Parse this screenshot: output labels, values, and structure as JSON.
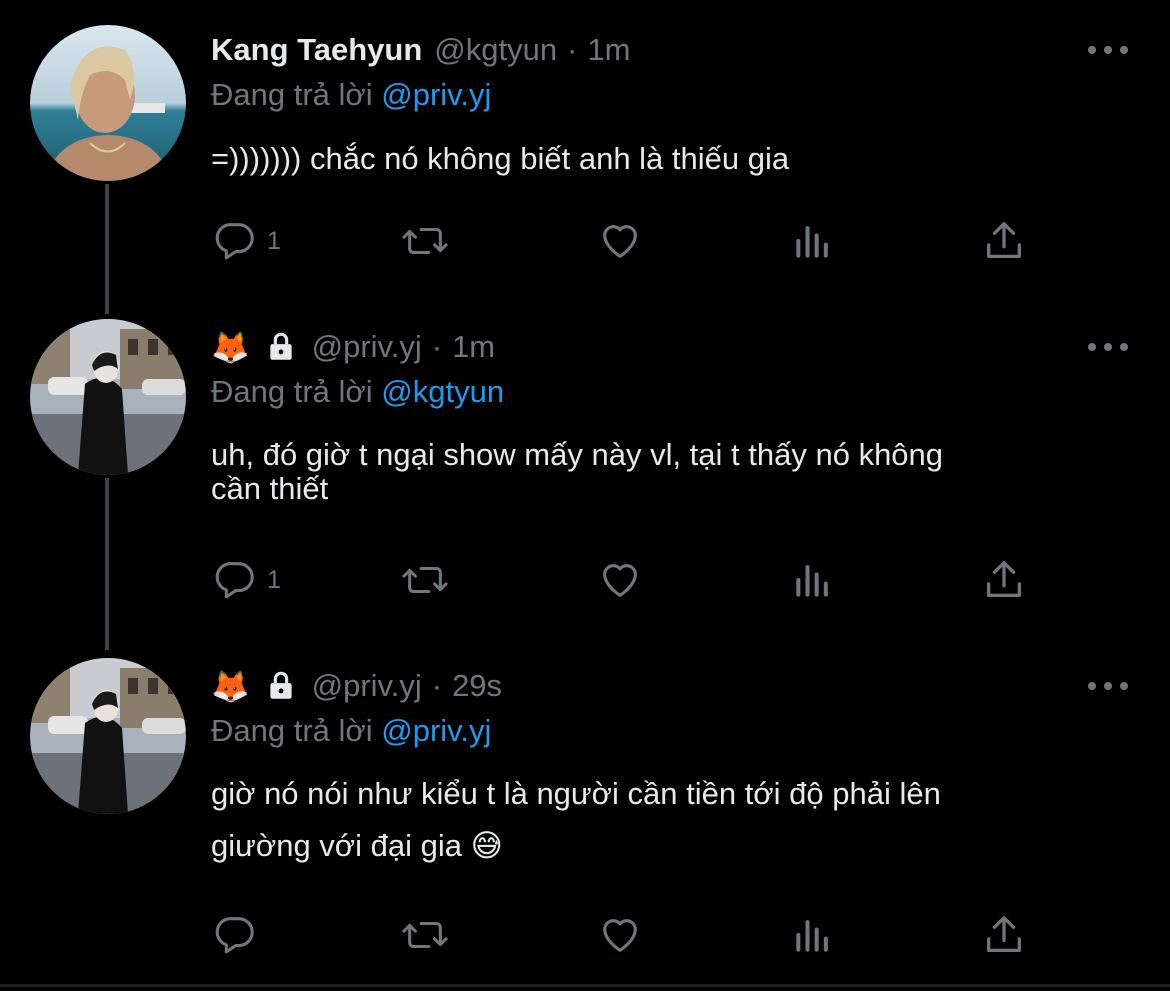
{
  "colors": {
    "background": "#000000",
    "text": "#e7e9ea",
    "muted": "#71767b",
    "link": "#1d9bf0",
    "thread_line": "#3e4144"
  },
  "tweets": [
    {
      "display_name": "Kang Taehyun",
      "handle": "@kgtyun",
      "separator": "·",
      "time": "1m",
      "reply_prefix": "Đang trả lời",
      "reply_mention": "@priv.yj",
      "text": "=))))))) chắc nó không biết anh là thiếu gia",
      "reply_count": "1",
      "icons": [
        "reply-icon",
        "retweet-icon",
        "like-icon",
        "views-icon",
        "share-icon",
        "more-icon"
      ]
    },
    {
      "display_name_emoji": "🦊",
      "locked": true,
      "handle": "@priv.yj",
      "separator": "·",
      "time": "1m",
      "reply_prefix": "Đang trả lời",
      "reply_mention": "@kgtyun",
      "text_line1": "uh, đó giờ t ngại show mấy này vl, tại t thấy nó không",
      "text_line2": "cần thiết",
      "reply_count": "1",
      "icons": [
        "reply-icon",
        "retweet-icon",
        "like-icon",
        "views-icon",
        "share-icon",
        "more-icon"
      ]
    },
    {
      "display_name_emoji": "🦊",
      "locked": true,
      "handle": "@priv.yj",
      "separator": "·",
      "time": "29s",
      "reply_prefix": "Đang trả lời",
      "reply_mention": "@priv.yj",
      "text_line1": "giờ nó nói như kiểu t là người cần tiền tới độ phải lên",
      "text_line2": "giường với đại gia 😅",
      "reply_count": "",
      "icons": [
        "reply-icon",
        "retweet-icon",
        "like-icon",
        "views-icon",
        "share-icon",
        "more-icon"
      ]
    }
  ]
}
